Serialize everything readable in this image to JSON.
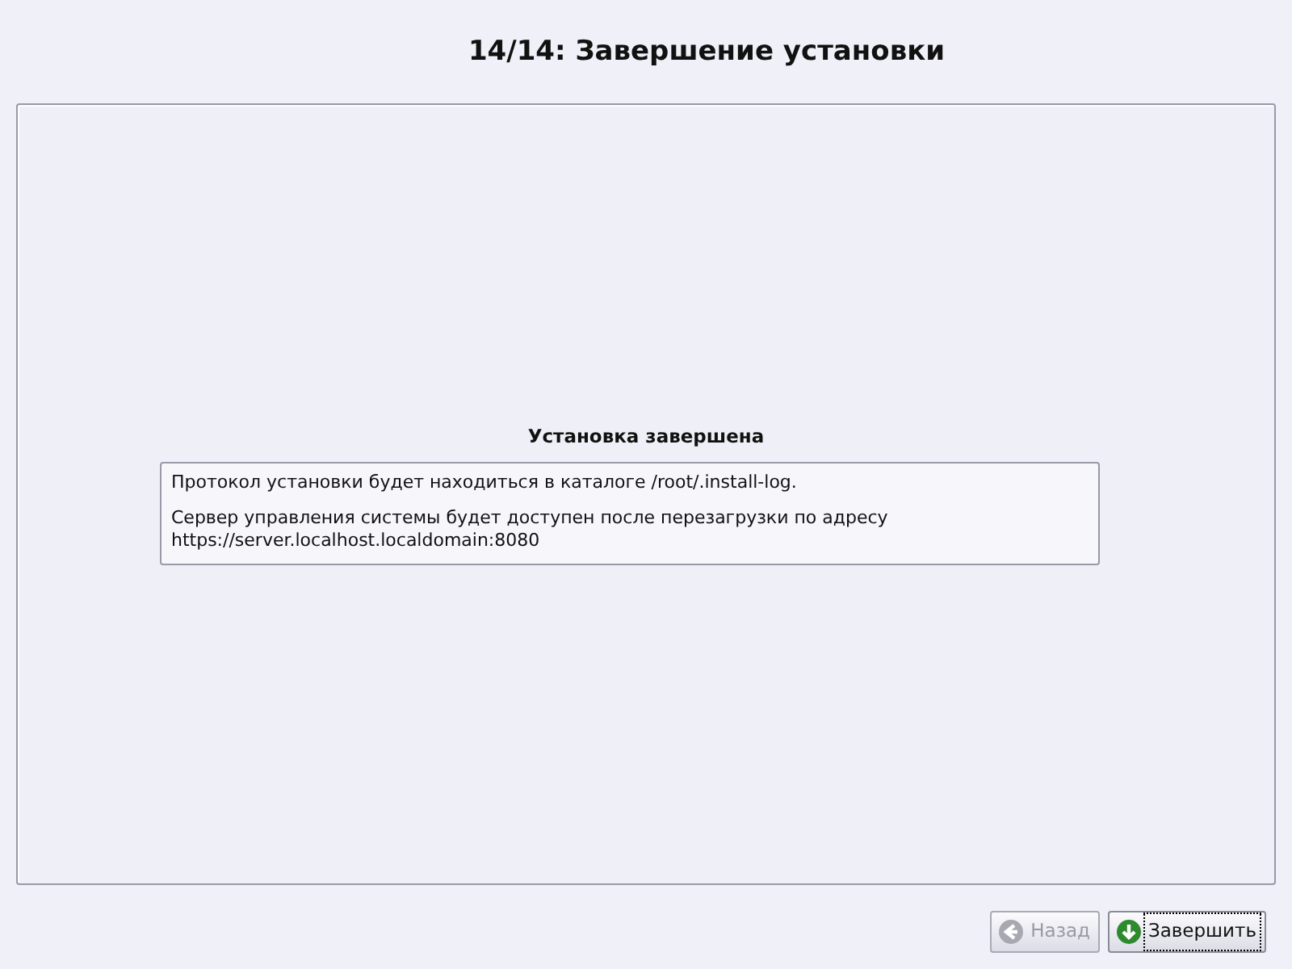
{
  "window": {
    "title": "14/14: Завершение установки"
  },
  "section": {
    "heading": "Установка завершена",
    "paragraphs": [
      "Протокол установки будет находиться в каталоге /root/.install-log.",
      "Сервер управления системы будет доступен после перезагрузки по адресу https://server.localhost.localdomain:8080"
    ]
  },
  "buttons": [
    {
      "label": "Назад",
      "kind": "back",
      "disabled": true,
      "focused": false
    },
    {
      "label": "Завершить",
      "kind": "finish",
      "disabled": false,
      "focused": true
    }
  ]
}
